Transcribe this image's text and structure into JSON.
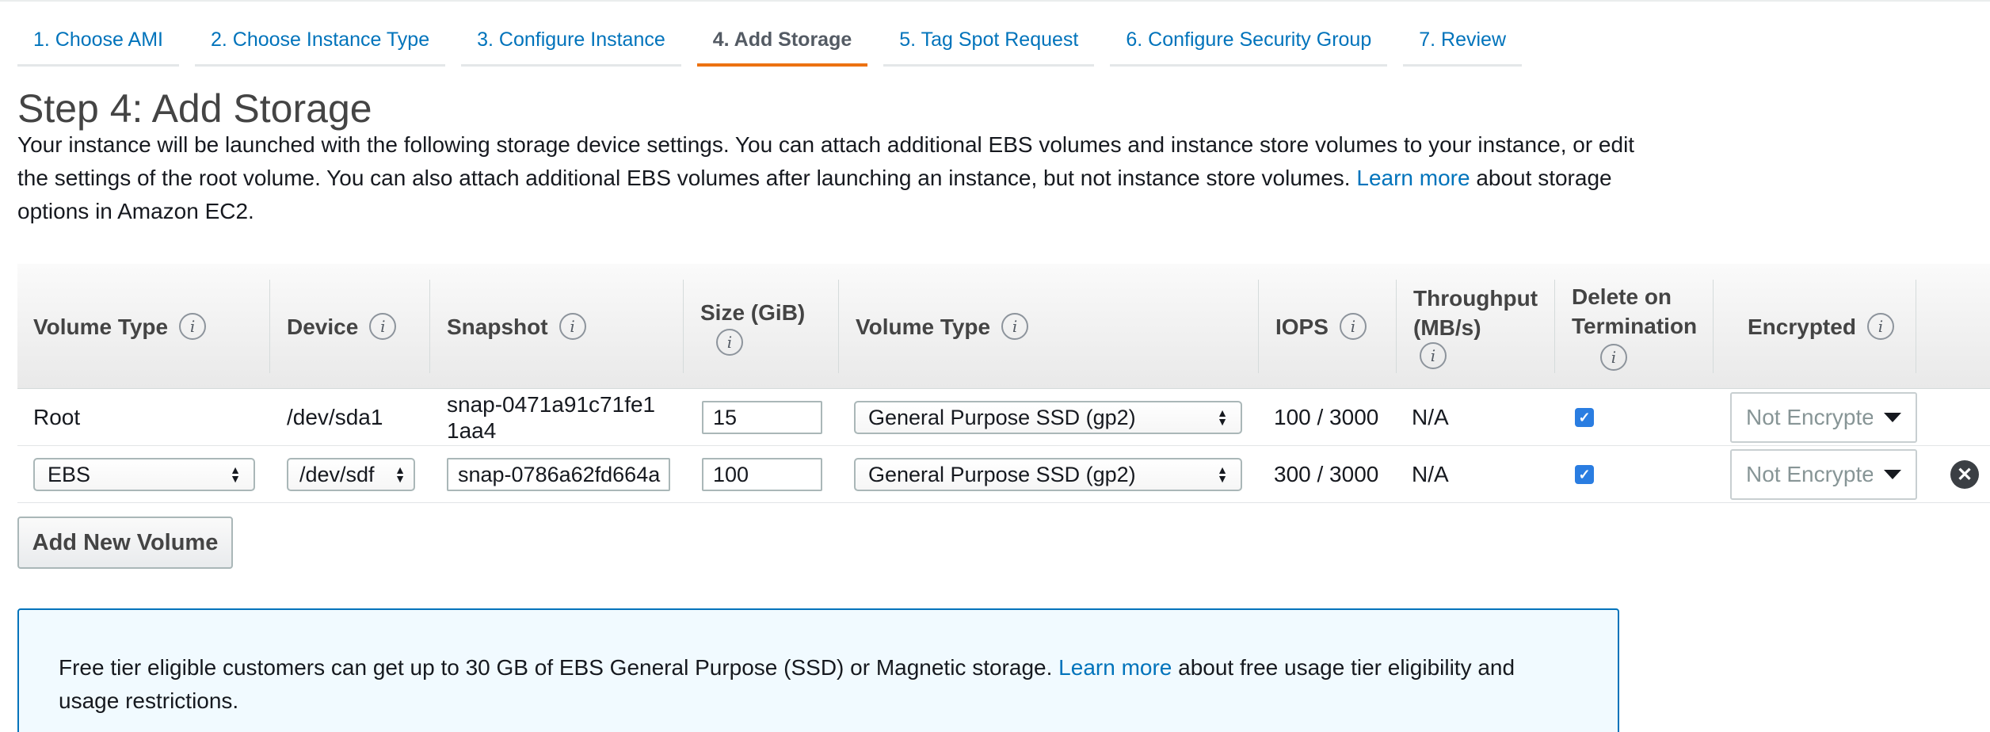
{
  "tabs": [
    {
      "label": "1. Choose AMI"
    },
    {
      "label": "2. Choose Instance Type"
    },
    {
      "label": "3. Configure Instance"
    },
    {
      "label": "4. Add Storage"
    },
    {
      "label": "5. Tag Spot Request"
    },
    {
      "label": "6. Configure Security Group"
    },
    {
      "label": "7. Review"
    }
  ],
  "page": {
    "title": "Step 4: Add Storage",
    "intro_text": "Your instance will be launched with the following storage device settings. You can attach additional EBS volumes and instance store volumes to your instance, or edit the settings of the root volume. You can also attach additional EBS volumes after launching an instance, but not instance store volumes.",
    "learn_more": "Learn more",
    "intro_suffix": "about storage options in Amazon EC2."
  },
  "table": {
    "headers": {
      "volume_type": "Volume Type",
      "device": "Device",
      "snapshot": "Snapshot",
      "size": "Size (GiB)",
      "volume_type2": "Volume Type",
      "iops": "IOPS",
      "throughput": "Throughput (MB/s)",
      "delete_on_termination": "Delete on Termination",
      "encrypted": "Encrypted"
    },
    "info_icon_glyph": "i",
    "rows": [
      {
        "volume_type": "Root",
        "device": "/dev/sda1",
        "snapshot": "snap-0471a91c71fe11aa4",
        "size": "15",
        "ebs_volume_type": "General Purpose SSD (gp2)",
        "iops": "100 / 3000",
        "throughput": "N/A",
        "delete_on_termination": true,
        "encrypted": "Not Encrypted"
      },
      {
        "volume_type": "EBS",
        "device": "/dev/sdf",
        "snapshot": "snap-0786a62fd664a",
        "size": "100",
        "ebs_volume_type": "General Purpose SSD (gp2)",
        "iops": "300 / 3000",
        "throughput": "N/A",
        "delete_on_termination": true,
        "encrypted": "Not Encrypted"
      }
    ]
  },
  "buttons": {
    "add_new_volume": "Add New Volume"
  },
  "alert": {
    "text": "Free tier eligible customers can get up to 30 GB of EBS General Purpose (SSD) or Magnetic storage.",
    "learn_more": "Learn more",
    "suffix": "about free usage tier eligibility and usage restrictions."
  },
  "icons": {
    "info": "info-icon",
    "checkbox": "checkmark-icon",
    "remove": "close-circle-icon",
    "caret": "caret-down-icon",
    "spinner": "up-down-arrows-icon"
  },
  "colors": {
    "link": "#0073bb",
    "active_tab_underline": "#ec7211",
    "checkbox": "#2a7de1",
    "alert_border": "#0073bb",
    "alert_background": "#f1faff"
  }
}
